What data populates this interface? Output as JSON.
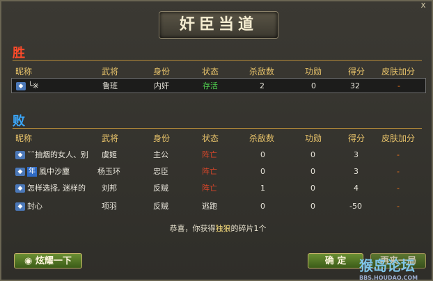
{
  "title": "奸臣当道",
  "close_label": "x",
  "winners": {
    "label": "胜",
    "headers": [
      "昵称",
      "武将",
      "身份",
      "状态",
      "杀敌数",
      "功勋",
      "得分",
      "皮肤加分"
    ],
    "rows": [
      {
        "nickname": "╰※",
        "general": "鲁班",
        "role": "内奸",
        "status": "存活",
        "kills": "2",
        "merit": "0",
        "score": "32",
        "skin": "-"
      }
    ]
  },
  "losers": {
    "label": "败",
    "headers": [
      "昵称",
      "武将",
      "身份",
      "状态",
      "杀敌数",
      "功勋",
      "得分",
      "皮肤加分"
    ],
    "rows": [
      {
        "nickname": "˜˜抽烟的女人、别",
        "general": "虞姬",
        "role": "主公",
        "status": "阵亡",
        "kills": "0",
        "merit": "0",
        "score": "3",
        "skin": "-"
      },
      {
        "nickname": "風中沙塵",
        "general": "杨玉环",
        "role": "忠臣",
        "status": "阵亡",
        "kills": "0",
        "merit": "0",
        "score": "3",
        "skin": "-"
      },
      {
        "nickname": "怎样选择, 迷样的",
        "general": "刘邦",
        "role": "反贼",
        "status": "阵亡",
        "kills": "1",
        "merit": "0",
        "score": "4",
        "skin": "-"
      },
      {
        "nickname": "封心",
        "general": "项羽",
        "role": "反贼",
        "status": "逃跑",
        "kills": "0",
        "merit": "0",
        "score": "-50",
        "skin": "-"
      }
    ]
  },
  "badge_nian": "年",
  "footer": {
    "prefix": "恭喜，你获得",
    "item": "独狼",
    "suffix": "的碎片1个"
  },
  "buttons": {
    "show_off": "炫耀一下",
    "confirm": "确 定",
    "again": "再来一局"
  },
  "watermark": {
    "brand": "猴岛论坛",
    "url": "BBS.HOUDAO.COM"
  }
}
